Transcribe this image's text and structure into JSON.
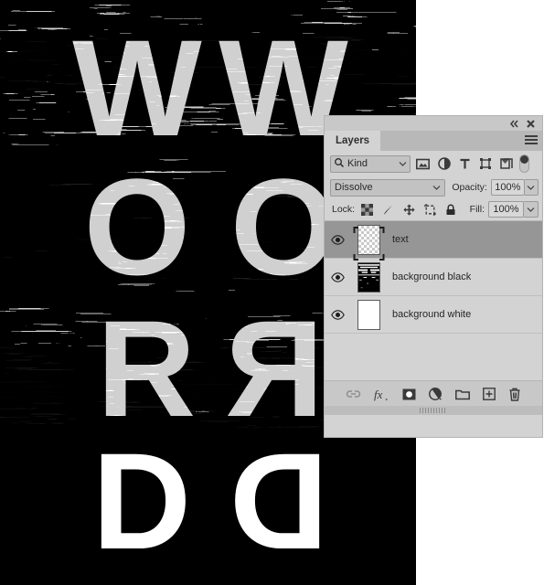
{
  "canvas": {
    "description": "dithered black-and-white photographic noise texture with large white mirrored letterforms",
    "letters": [
      "W",
      "O",
      "R",
      "D"
    ],
    "mirrored": true,
    "foreground_color": "#ffffff",
    "background_color": "#000000"
  },
  "panel": {
    "titlebar": {
      "collapse_icon": "double-chevron-left-icon",
      "close_icon": "close-icon"
    },
    "tabs": [
      {
        "label": "Layers",
        "active": true
      }
    ],
    "menu_icon": "hamburger-menu-icon",
    "filter": {
      "search_icon": "search-icon",
      "kind_label": "Kind",
      "caret_icon": "chevron-down-icon",
      "type_filters": [
        {
          "name": "filter-pixel-layers",
          "icon": "image-icon"
        },
        {
          "name": "filter-adjustment-layers",
          "icon": "half-circle-icon"
        },
        {
          "name": "filter-type-layers",
          "icon": "text-T-icon"
        },
        {
          "name": "filter-shape-layers",
          "icon": "shape-bounds-icon"
        },
        {
          "name": "filter-smart-objects",
          "icon": "smart-object-icon"
        }
      ],
      "toggle_name": "filter-enable-toggle"
    },
    "blend": {
      "mode": "Dissolve",
      "opacity_label": "Opacity:",
      "opacity_value": "100%"
    },
    "lock": {
      "label": "Lock:",
      "items": [
        {
          "name": "lock-transparent-pixels",
          "icon": "checkerboard-icon"
        },
        {
          "name": "lock-image-pixels",
          "icon": "brush-icon"
        },
        {
          "name": "lock-position",
          "icon": "move-arrows-icon"
        },
        {
          "name": "lock-artboard-nesting",
          "icon": "artboard-icon"
        },
        {
          "name": "lock-all",
          "icon": "padlock-icon"
        }
      ],
      "fill_label": "Fill:",
      "fill_value": "100%"
    },
    "layers": [
      {
        "name": "text",
        "visible": true,
        "selected": true,
        "thumb": "transparent-checker",
        "has_selection_brackets": true
      },
      {
        "name": "background black",
        "visible": true,
        "selected": false,
        "thumb": "noise-black",
        "has_selection_brackets": false
      },
      {
        "name": "background white",
        "visible": true,
        "selected": false,
        "thumb": "solid-white",
        "has_selection_brackets": false
      }
    ],
    "bottom_toolbar": [
      {
        "name": "link-layers-button",
        "icon": "link-icon"
      },
      {
        "name": "layer-style-button",
        "icon": "fx-icon"
      },
      {
        "name": "add-layer-mask-button",
        "icon": "mask-icon"
      },
      {
        "name": "new-adjustment-layer-button",
        "icon": "half-circle-icon"
      },
      {
        "name": "new-group-button",
        "icon": "folder-icon"
      },
      {
        "name": "new-layer-button",
        "icon": "plus-square-icon"
      },
      {
        "name": "delete-layer-button",
        "icon": "trash-icon"
      }
    ]
  }
}
